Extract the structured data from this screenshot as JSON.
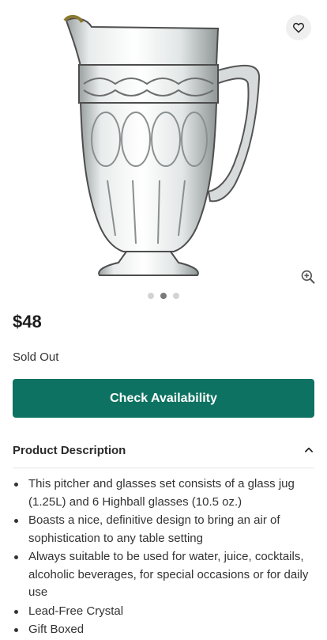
{
  "gallery": {
    "image_alt": "Crystal glass pitcher",
    "favorite_icon": "heart-outline-icon",
    "zoom_icon": "zoom-in-icon",
    "dots": [
      false,
      true,
      false
    ]
  },
  "product": {
    "price": "$48",
    "stock_status": "Sold Out",
    "check_button_label": "Check Availability"
  },
  "description": {
    "title": "Product Description",
    "toggle_icon": "chevron-up-icon",
    "bullets": [
      "This pitcher and glasses set consists of a glass jug (1.25L) and 6 Highball glasses (10.5 oz.)",
      "Boasts a nice, definitive design to bring an air of sophistication to any table setting",
      "Always suitable to be used for water, juice, cocktails, alcoholic beverages, for special occasions or for daily use",
      "Lead-Free Crystal",
      "Gift Boxed"
    ]
  },
  "colors": {
    "primary": "#0d7261",
    "text": "#333333",
    "favorite_bg": "#efefef"
  }
}
